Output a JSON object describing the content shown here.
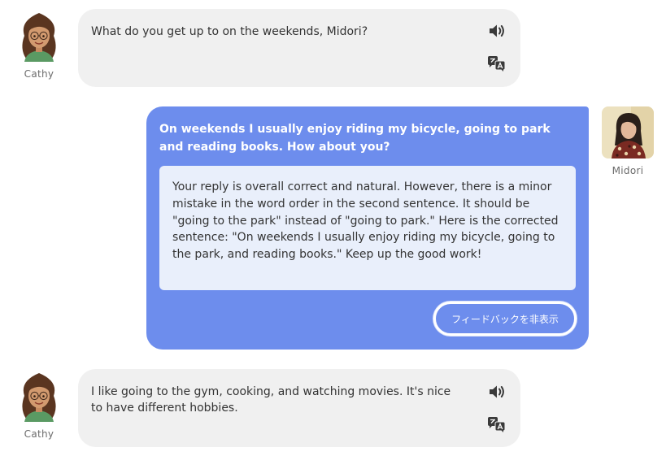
{
  "messages": [
    {
      "speaker": "Cathy",
      "text": "What do you get up to on the weekends, Midori?",
      "speak_icon": "speaker-icon",
      "translate_icon": "translate-icon"
    },
    {
      "speaker": "Midori",
      "text": "On weekends I usually enjoy riding my bicycle, going to park and reading books. How about you?",
      "feedback": "Your reply is overall correct and natural. However, there is a minor mistake in the word order in the second sentence. It should be \"going to the park\" instead of \"going to park.\" Here is the corrected sentence: \"On weekends I usually enjoy riding my bicycle, going to the park, and reading books.\" Keep up the good work!",
      "hide_feedback_label": "フィードバックを非表示"
    },
    {
      "speaker": "Cathy",
      "text": "I like going to the gym, cooking, and watching movies. It's nice to have different hobbies.",
      "speak_icon": "speaker-icon",
      "translate_icon": "translate-icon"
    }
  ],
  "colors": {
    "user_bubble": "#6d8ded",
    "ai_bubble": "#f0f0f0",
    "feedback_box": "#e9effb"
  }
}
